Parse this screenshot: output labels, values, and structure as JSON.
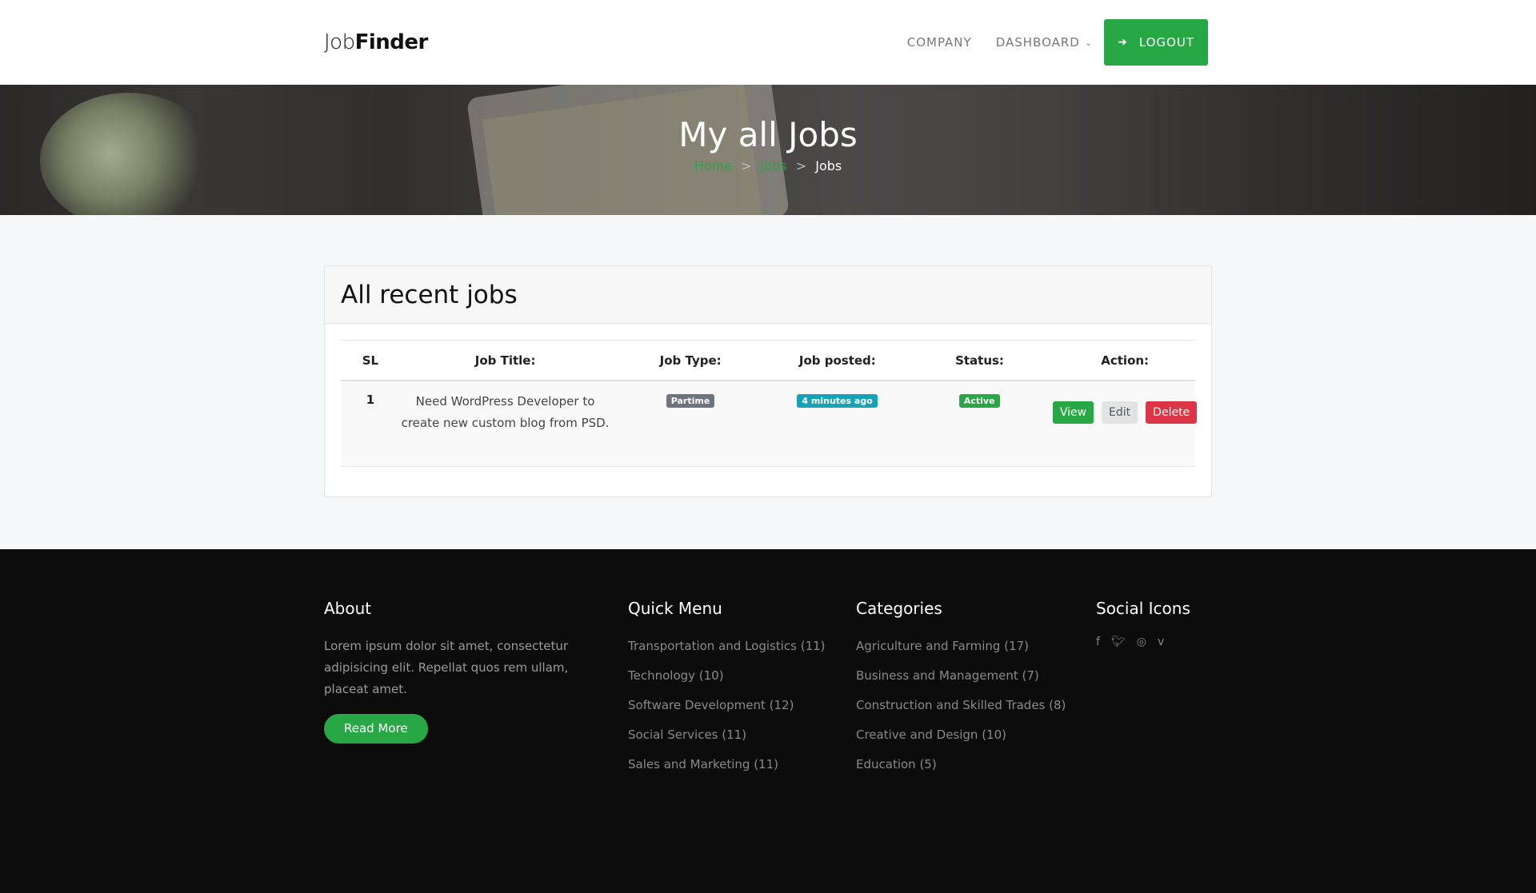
{
  "brand": {
    "light": "Job",
    "bold": "Finder"
  },
  "nav": {
    "company": "COMPANY",
    "dashboard": "DASHBOARD",
    "logout": "LOGOUT"
  },
  "hero": {
    "title": "My all Jobs",
    "breadcrumb": {
      "home": "Home",
      "jobs_link": "Jobs",
      "current": "Jobs",
      "sep": ">"
    }
  },
  "card": {
    "title": "All recent jobs",
    "headers": [
      "SL",
      "Job Title:",
      "Job Type:",
      "Job posted:",
      "Status:",
      "Action:"
    ],
    "rows": [
      {
        "sl": "1",
        "title": "Need WordPress Developer to create new custom blog from PSD.",
        "type": "Partime",
        "posted": "4 minutes ago",
        "status": "Active",
        "actions": {
          "view": "View",
          "edit": "Edit",
          "delete": "Delete"
        }
      }
    ]
  },
  "footer": {
    "about": {
      "heading": "About",
      "text": "Lorem ipsum dolor sit amet, consectetur adipisicing elit. Repellat quos rem ullam, placeat amet.",
      "button": "Read More"
    },
    "quick_menu": {
      "heading": "Quick Menu",
      "items": [
        "Transportation and Logistics (11)",
        "Technology (10)",
        "Software Development (12)",
        "Social Services (11)",
        "Sales and Marketing (11)"
      ]
    },
    "categories": {
      "heading": "Categories",
      "items": [
        "Agriculture and Farming (17)",
        "Business and Management (7)",
        "Construction and Skilled Trades (8)",
        "Creative and Design (10)",
        "Education (5)"
      ]
    },
    "social": {
      "heading": "Social Icons",
      "icons": [
        "facebook-icon",
        "twitter-icon",
        "instagram-icon",
        "vimeo-icon"
      ]
    }
  },
  "colors": {
    "accent": "#28a745",
    "danger": "#dc3545",
    "info": "#17a2b8",
    "footer_bg": "#0c0c0c"
  }
}
